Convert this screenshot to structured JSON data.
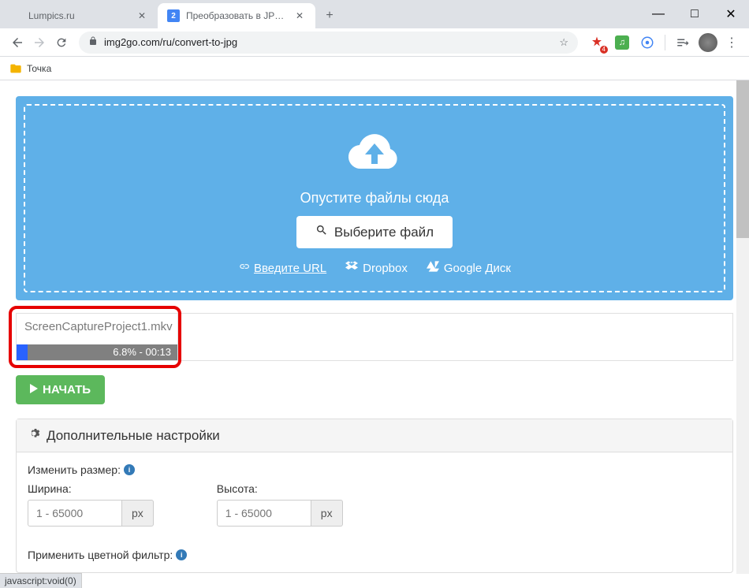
{
  "window": {
    "minimize": "—",
    "maximize": "□",
    "close": "✕"
  },
  "tabs": [
    {
      "title": "Lumpics.ru",
      "active": false
    },
    {
      "title": "Преобразовать в JPG — Конвер",
      "active": true,
      "favicon": "2"
    }
  ],
  "toolbar": {
    "url": "img2go.com/ru/convert-to-jpg"
  },
  "bookmarks": [
    {
      "label": "Точка"
    }
  ],
  "dropzone": {
    "text": "Опустите файлы сюда",
    "select_label": "Выберите файл",
    "links": {
      "url": "Введите URL",
      "dropbox": "Dropbox",
      "gdrive": "Google Диск"
    }
  },
  "upload": {
    "filename": "ScreenCaptureProject1.mkv",
    "progress_text": "6.8% - 00:13",
    "progress_pct": 6.8
  },
  "start_label": "НАЧАТЬ",
  "settings": {
    "head": "Дополнительные настройки",
    "resize_label": "Изменить размер:",
    "width_label": "Ширина:",
    "height_label": "Высота:",
    "placeholder": "1 - 65000",
    "unit": "px",
    "filter_label": "Применить цветной фильтр:"
  },
  "statusbar": "javascript:void(0)"
}
